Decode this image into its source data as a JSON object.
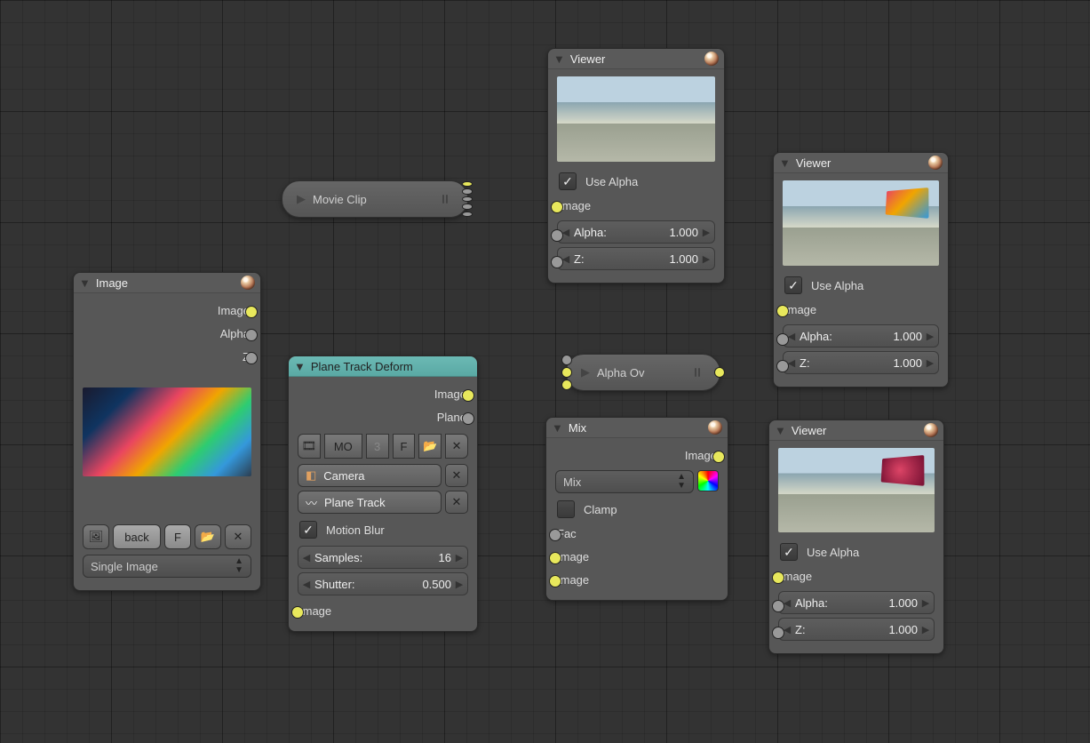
{
  "image_node": {
    "title": "Image",
    "out_image": "Image",
    "out_alpha": "Alpha",
    "out_z": "Z",
    "filename": "back",
    "fake_user": "F",
    "source_mode": "Single Image"
  },
  "movie_clip": {
    "title": "Movie Clip"
  },
  "plane_track": {
    "title": "Plane Track Deform",
    "out_image": "Image",
    "out_plane": "Plane",
    "clip_abbrev": "MO",
    "clip_users": "3",
    "fake_user": "F",
    "object": "Camera",
    "track": "Plane Track",
    "motion_blur": "Motion Blur",
    "samples_label": "Samples:",
    "samples_val": "16",
    "shutter_label": "Shutter:",
    "shutter_val": "0.500",
    "in_image": "Image"
  },
  "alpha_over": {
    "title": "Alpha Ov"
  },
  "mix": {
    "title": "Mix",
    "out_image": "Image",
    "mode": "Mix",
    "clamp": "Clamp",
    "in_fac": "Fac",
    "in_image1": "Image",
    "in_image2": "Image"
  },
  "viewer1": {
    "title": "Viewer",
    "use_alpha": "Use Alpha",
    "in_image": "Image",
    "alpha_label": "Alpha:",
    "alpha_val": "1.000",
    "z_label": "Z:",
    "z_val": "1.000"
  },
  "viewer2": {
    "title": "Viewer",
    "use_alpha": "Use Alpha",
    "in_image": "Image",
    "alpha_label": "Alpha:",
    "alpha_val": "1.000",
    "z_label": "Z:",
    "z_val": "1.000"
  },
  "viewer3": {
    "title": "Viewer",
    "use_alpha": "Use Alpha",
    "in_image": "Image",
    "alpha_label": "Alpha:",
    "alpha_val": "1.000",
    "z_label": "Z:",
    "z_val": "1.000"
  }
}
